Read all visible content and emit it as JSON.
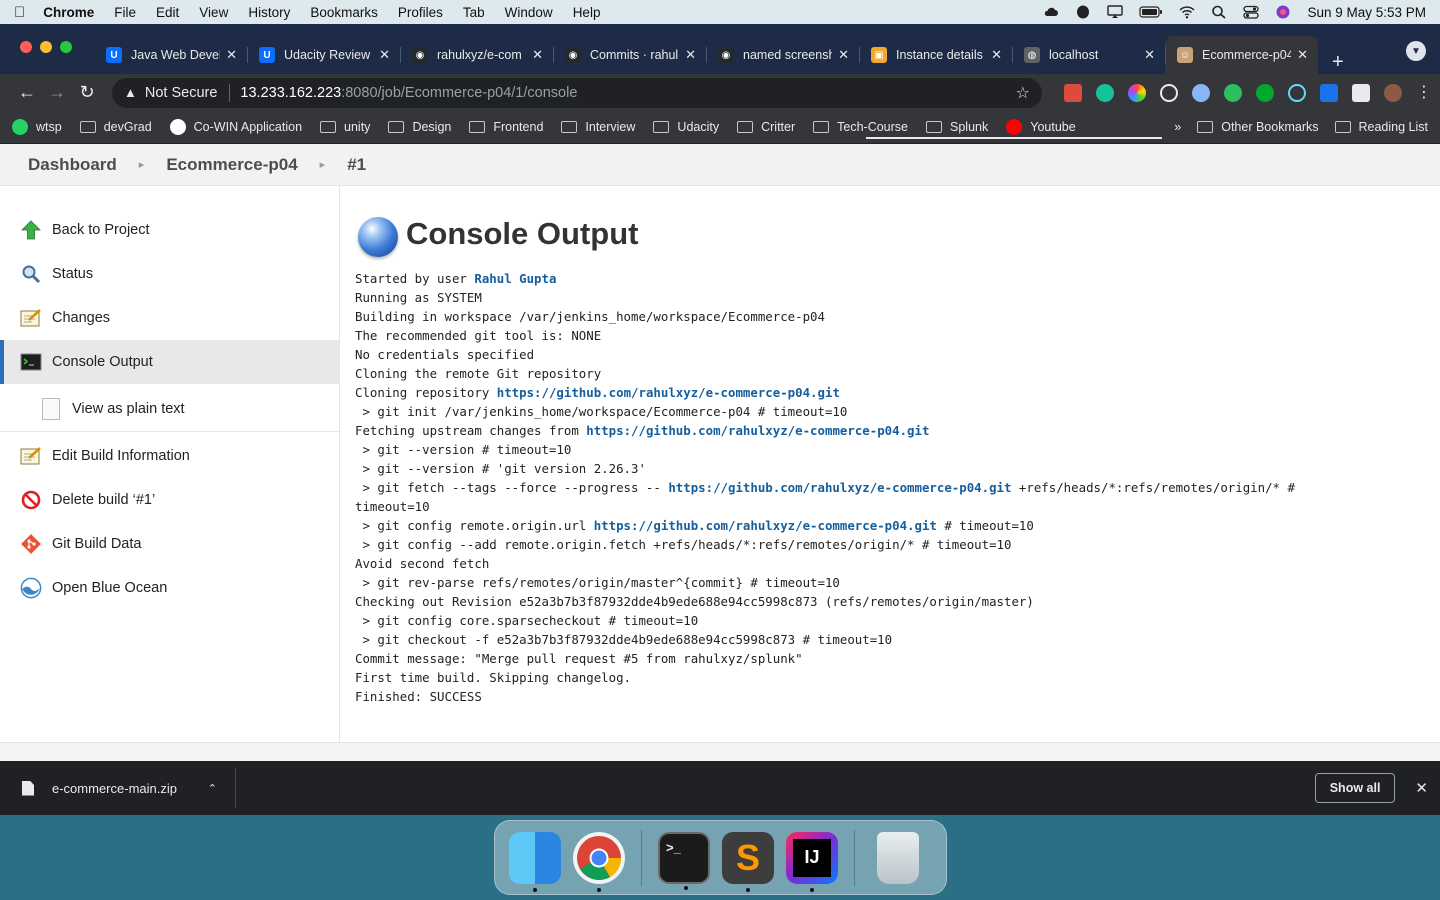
{
  "menubar": {
    "app": "Chrome",
    "items": [
      "File",
      "Edit",
      "View",
      "History",
      "Bookmarks",
      "Profiles",
      "Tab",
      "Window",
      "Help"
    ],
    "datetime": "Sun 9 May  5:53 PM"
  },
  "tabs": [
    {
      "title": "Java Web Devel",
      "fav_color": "#0d6efd",
      "fav_glyph": "U"
    },
    {
      "title": "Udacity Review",
      "fav_color": "#0d6efd",
      "fav_glyph": "U"
    },
    {
      "title": "rahulxyz/e-com",
      "fav_color": "#24292e",
      "fav_glyph": "◉"
    },
    {
      "title": "Commits · rahul",
      "fav_color": "#24292e",
      "fav_glyph": "◉"
    },
    {
      "title": "named screensh",
      "fav_color": "#24292e",
      "fav_glyph": "◉"
    },
    {
      "title": "Instance details",
      "fav_color": "#f0a830",
      "fav_glyph": "▣"
    },
    {
      "title": "localhost",
      "fav_color": "#5f6368",
      "fav_glyph": "◍"
    },
    {
      "title": "Ecommerce-p04",
      "fav_color": "#c9a27a",
      "fav_glyph": "☺"
    }
  ],
  "address": {
    "security": "Not Secure",
    "host": "13.233.162.223",
    "path": ":8080/job/Ecommerce-p04/1/console"
  },
  "bookmarks": [
    {
      "label": "wtsp",
      "type": "round",
      "color": "#25d366"
    },
    {
      "label": "devGrad",
      "type": "folder"
    },
    {
      "label": "Co-WIN Application",
      "type": "round",
      "color": "#ffffff"
    },
    {
      "label": "unity",
      "type": "folder"
    },
    {
      "label": "Design",
      "type": "folder"
    },
    {
      "label": "Frontend",
      "type": "folder"
    },
    {
      "label": "Interview",
      "type": "folder"
    },
    {
      "label": "Udacity",
      "type": "folder"
    },
    {
      "label": "Critter",
      "type": "folder"
    },
    {
      "label": "Tech-Course",
      "type": "folder"
    },
    {
      "label": "Splunk",
      "type": "folder"
    },
    {
      "label": "Youtube",
      "type": "round",
      "color": "#ff0000"
    }
  ],
  "bookmarks_right": {
    "overflow": "»",
    "other": "Other Bookmarks",
    "reading": "Reading List"
  },
  "breadcrumbs": [
    "Dashboard",
    "Ecommerce-p04",
    "#1"
  ],
  "sidebar": {
    "items": [
      {
        "label": "Back to Project",
        "icon": "up-arrow-icon"
      },
      {
        "label": "Status",
        "icon": "magnifier-icon"
      },
      {
        "label": "Changes",
        "icon": "notepad-icon"
      },
      {
        "label": "Console Output",
        "icon": "terminal-icon"
      },
      {
        "label": "View as plain text",
        "icon": "document-icon"
      },
      {
        "label": "Edit Build Information",
        "icon": "notepad-icon"
      },
      {
        "label": "Delete build ‘#1’",
        "icon": "no-entry-icon"
      },
      {
        "label": "Git Build Data",
        "icon": "git-icon"
      },
      {
        "label": "Open Blue Ocean",
        "icon": "blue-ocean-icon"
      }
    ]
  },
  "console": {
    "title": "Console Output",
    "user_prefix": "Started by user ",
    "user_name": "Rahul Gupta",
    "repo_url": "https://github.com/rahulxyz/e-commerce-p04.git",
    "lines": {
      "l2": "Running as SYSTEM",
      "l3": "Building in workspace /var/jenkins_home/workspace/Ecommerce-p04",
      "l4": "The recommended git tool is: NONE",
      "l5": "No credentials specified",
      "l6": "Cloning the remote Git repository",
      "l7_pre": "Cloning repository ",
      "l8": " > git init /var/jenkins_home/workspace/Ecommerce-p04 # timeout=10",
      "l9_pre": "Fetching upstream changes from ",
      "l10": " > git --version # timeout=10",
      "l11": " > git --version # 'git version 2.26.3'",
      "l12_pre": " > git fetch --tags --force --progress -- ",
      "l12_post": " +refs/heads/*:refs/remotes/origin/* #",
      "l13": "timeout=10",
      "l14_pre": " > git config remote.origin.url ",
      "l14_post": " # timeout=10",
      "l15": " > git config --add remote.origin.fetch +refs/heads/*:refs/remotes/origin/* # timeout=10",
      "l16": "Avoid second fetch",
      "l17": " > git rev-parse refs/remotes/origin/master^{commit} # timeout=10",
      "l18": "Checking out Revision e52a3b7b3f87932dde4b9ede688e94cc5998c873 (refs/remotes/origin/master)",
      "l19": " > git config core.sparsecheckout # timeout=10",
      "l20": " > git checkout -f e52a3b7b3f87932dde4b9ede688e94cc5998c873 # timeout=10",
      "l21": "Commit message: \"Merge pull request #5 from rahulxyz/splunk\"",
      "l22": "First time build. Skipping changelog.",
      "l23": "Finished: SUCCESS"
    }
  },
  "download": {
    "filename": "e-commerce-main.zip",
    "show_all": "Show all"
  },
  "dock": [
    "finder-icon",
    "chrome-icon",
    "terminal-icon",
    "sublime-text-icon",
    "intellij-icon",
    "trash-icon"
  ]
}
